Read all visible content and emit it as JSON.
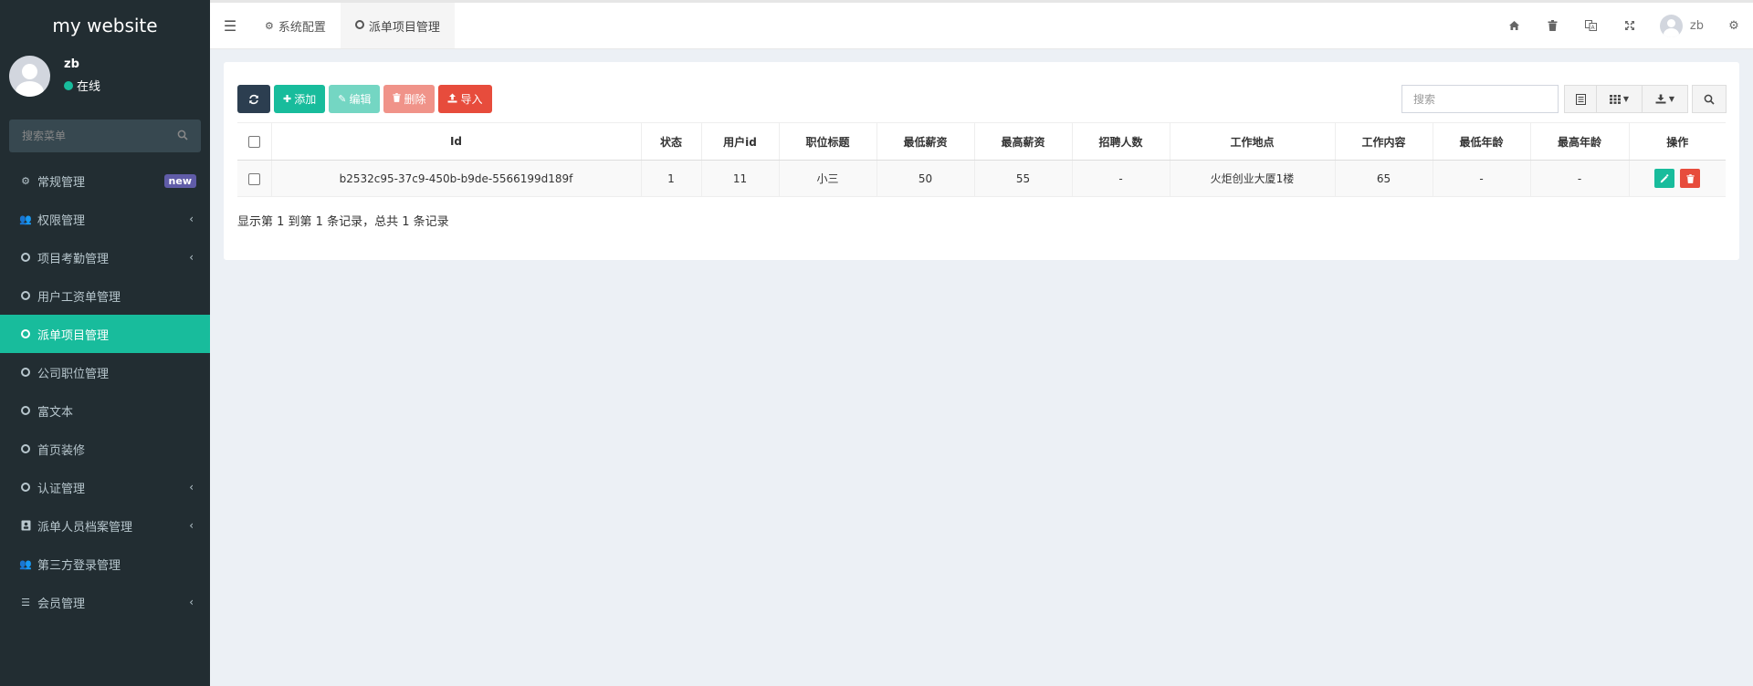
{
  "sidebar": {
    "brand": "my website",
    "user": {
      "name": "zb",
      "status": "在线"
    },
    "search_placeholder": "搜索菜单",
    "items": [
      {
        "label": "常规管理",
        "badge": "new"
      },
      {
        "label": "权限管理",
        "chevron": "‹"
      },
      {
        "label": "项目考勤管理",
        "chevron": "‹"
      },
      {
        "label": "用户工资单管理"
      },
      {
        "label": "派单项目管理"
      },
      {
        "label": "公司职位管理"
      },
      {
        "label": "富文本"
      },
      {
        "label": "首页装修"
      },
      {
        "label": "认证管理",
        "chevron": "‹"
      },
      {
        "label": "派单人员档案管理",
        "chevron": "‹"
      },
      {
        "label": "第三方登录管理"
      },
      {
        "label": "会员管理",
        "chevron": "‹"
      }
    ]
  },
  "topbar": {
    "tabs": [
      {
        "label": "系统配置"
      },
      {
        "label": "派单项目管理"
      }
    ],
    "user_name": "zb"
  },
  "toolbar": {
    "add_label": "添加",
    "edit_label": "编辑",
    "delete_label": "删除",
    "import_label": "导入",
    "search_placeholder": "搜索"
  },
  "table": {
    "columns": [
      "Id",
      "状态",
      "用户id",
      "职位标题",
      "最低薪资",
      "最高薪资",
      "招聘人数",
      "工作地点",
      "工作内容",
      "最低年龄",
      "最高年龄",
      "操作"
    ],
    "rows": [
      [
        "b2532c95-37c9-450b-b9de-5566199d189f",
        "1",
        "11",
        "小三",
        "50",
        "55",
        "-",
        "火炬创业大厦1楼",
        "65",
        "-",
        "-"
      ]
    ]
  },
  "pagination": {
    "info": "显示第 1 到第 1 条记录，总共 1 条记录"
  },
  "colors": {
    "sidebar_bg": "#222d32",
    "accent": "#18bc9c",
    "danger": "#e74c3c",
    "dark_button": "#2c3e50",
    "badge": "#605ca8"
  }
}
